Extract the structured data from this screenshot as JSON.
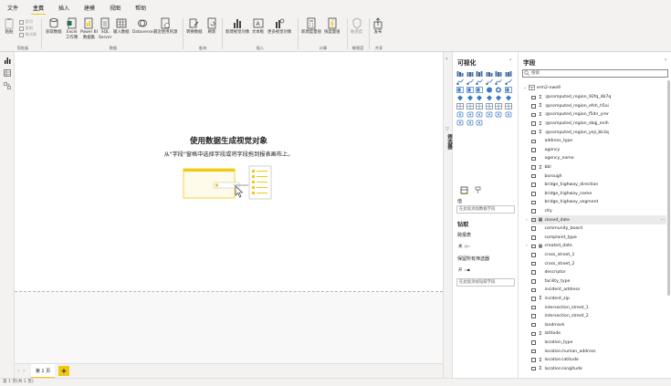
{
  "menu": [
    "文件",
    "主页",
    "插入",
    "建模",
    "视图",
    "帮助"
  ],
  "menu_active_index": 1,
  "ribbon": {
    "clipboard": {
      "paste": "粘贴",
      "cut": "剪切",
      "copy": "复制",
      "format_painter": "格式刷",
      "group": "剪贴板"
    },
    "data": {
      "get_data": "获取数据",
      "excel": "Excel\n工作簿",
      "powerbi": "Power BI\n数据集",
      "sql": "SQL\nServer",
      "enter_data": "输入数据",
      "dataverse": "Dataverse",
      "recent_sources": "最近使用的源",
      "group": "数据"
    },
    "queries": {
      "transform": "转换数据",
      "refresh": "刷新",
      "group": "查询"
    },
    "insert": {
      "new_visual": "新建视觉对象",
      "text_box": "文本框",
      "more_visuals": "更多视觉对象",
      "group": "插入"
    },
    "calc": {
      "new_measure": "新建度量值",
      "quick_measure": "快度量值",
      "group": "计算"
    },
    "sensitivity": {
      "label": "敏感度",
      "group": "敏感度"
    },
    "share": {
      "publish": "发布",
      "group": "共享"
    }
  },
  "canvas": {
    "title": "使用数据生成视觉对象",
    "subtitle": "从\"字段\"窗格中选择字段或将字段拖到报表画布上。"
  },
  "page_tab": "第 1 页",
  "add_page": "+",
  "status": "第 1 页(共 1 页)",
  "filters": {
    "label": "筛选器"
  },
  "viz": {
    "title": "可视化",
    "values_label": "值",
    "values_drop": "在此处添加数据字段",
    "drillthrough": "钻取",
    "cross_report": "跨报表",
    "cross_report_toggle": "关",
    "keep_filters": "保留所有筛选器",
    "keep_filters_toggle": "开",
    "drill_drop": "在此处添加钻取字段"
  },
  "fields": {
    "title": "字段",
    "search_placeholder": "搜索",
    "table": "erm2-nwe9",
    "items": [
      {
        "name": ":@computed_region_92fq_4b7q",
        "icon": "sigma"
      },
      {
        "name": ":@computed_region_efsh_h5xi",
        "icon": "sigma"
      },
      {
        "name": ":@computed_region_f5dn_yrer",
        "icon": "sigma"
      },
      {
        "name": ":@computed_region_sbqj_enih",
        "icon": "sigma"
      },
      {
        "name": ":@computed_region_yeji_bk3q",
        "icon": "sigma"
      },
      {
        "name": "address_type",
        "icon": ""
      },
      {
        "name": "agency",
        "icon": ""
      },
      {
        "name": "agency_name",
        "icon": ""
      },
      {
        "name": "bbl",
        "icon": "sigma"
      },
      {
        "name": "borough",
        "icon": ""
      },
      {
        "name": "bridge_highway_direction",
        "icon": ""
      },
      {
        "name": "bridge_highway_name",
        "icon": ""
      },
      {
        "name": "bridge_highway_segment",
        "icon": ""
      },
      {
        "name": "city",
        "icon": ""
      },
      {
        "name": "closed_date",
        "icon": "calendar",
        "expandable": true,
        "highlight": true
      },
      {
        "name": "community_board",
        "icon": ""
      },
      {
        "name": "complaint_type",
        "icon": ""
      },
      {
        "name": "created_date",
        "icon": "calendar",
        "expandable": true
      },
      {
        "name": "cross_street_1",
        "icon": ""
      },
      {
        "name": "cross_street_2",
        "icon": ""
      },
      {
        "name": "descriptor",
        "icon": ""
      },
      {
        "name": "facility_type",
        "icon": ""
      },
      {
        "name": "incident_address",
        "icon": ""
      },
      {
        "name": "incident_zip",
        "icon": "sigma"
      },
      {
        "name": "intersection_street_1",
        "icon": ""
      },
      {
        "name": "intersection_street_2",
        "icon": ""
      },
      {
        "name": "landmark",
        "icon": ""
      },
      {
        "name": "latitude",
        "icon": "sigma"
      },
      {
        "name": "location_type",
        "icon": ""
      },
      {
        "name": "location.human_address",
        "icon": ""
      },
      {
        "name": "location.latitude",
        "icon": "sigma"
      },
      {
        "name": "location.longitude",
        "icon": "sigma"
      }
    ]
  },
  "colors": {
    "accent": "#f2c811",
    "chrome": "#f3f2f1",
    "text": "#252423",
    "muted": "#605e5c",
    "viz_blue": "#3a78c9"
  }
}
